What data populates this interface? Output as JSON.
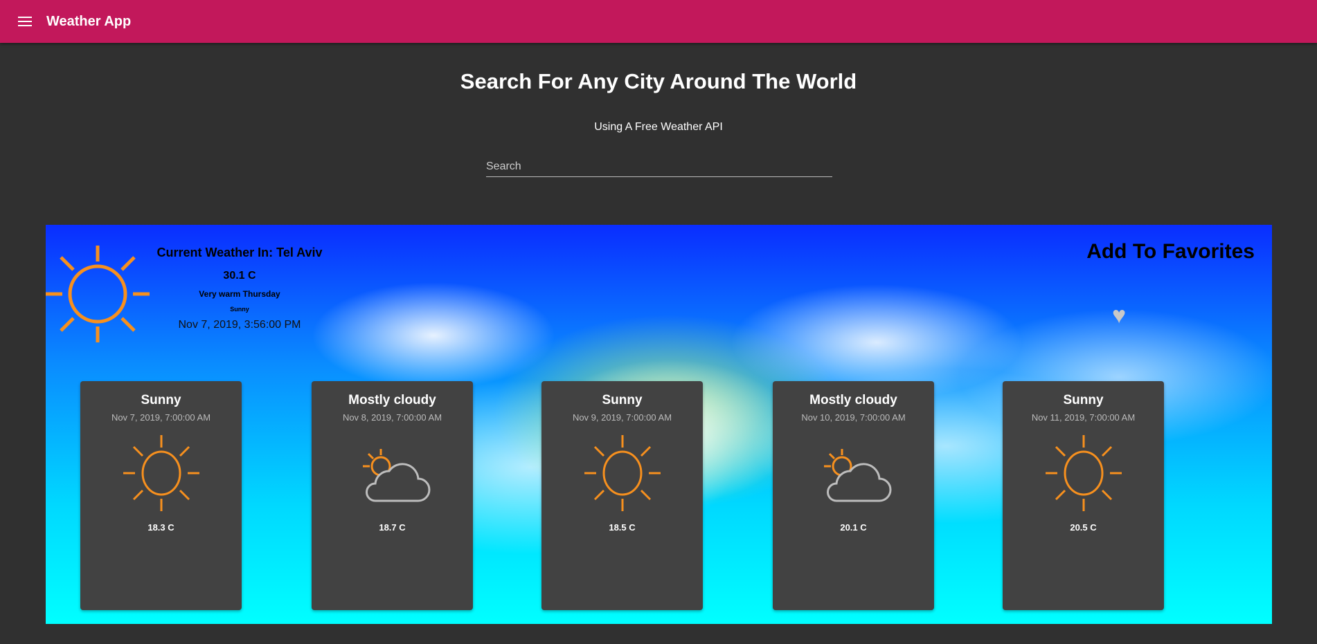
{
  "appbar": {
    "title": "Weather App"
  },
  "hero": {
    "title": "Search For Any City Around The World",
    "subtitle": "Using A Free Weather API"
  },
  "search": {
    "placeholder": "Search",
    "value": ""
  },
  "current": {
    "city_label": "Current Weather In: Tel Aviv",
    "temperature": "30.1 C",
    "description": "Very warm Thursday",
    "condition": "Sunny",
    "datetime": "Nov 7, 2019, 3:56:00 PM",
    "icon": "sun-icon"
  },
  "favorites": {
    "label": "Add To Favorites",
    "icon": "heart-icon"
  },
  "forecast": [
    {
      "condition": "Sunny",
      "date": "Nov 7, 2019, 7:00:00 AM",
      "temp": "18.3 C",
      "icon": "sun"
    },
    {
      "condition": "Mostly cloudy",
      "date": "Nov 8, 2019, 7:00:00 AM",
      "temp": "18.7 C",
      "icon": "cloud"
    },
    {
      "condition": "Sunny",
      "date": "Nov 9, 2019, 7:00:00 AM",
      "temp": "18.5 C",
      "icon": "sun"
    },
    {
      "condition": "Mostly cloudy",
      "date": "Nov 10, 2019, 7:00:00 AM",
      "temp": "20.1 C",
      "icon": "cloud"
    },
    {
      "condition": "Sunny",
      "date": "Nov 11, 2019, 7:00:00 AM",
      "temp": "20.5 C",
      "icon": "sun"
    }
  ],
  "colors": {
    "appbar": "#c2185b",
    "background": "#303030",
    "card": "#424242",
    "sun": "#f7901e"
  }
}
